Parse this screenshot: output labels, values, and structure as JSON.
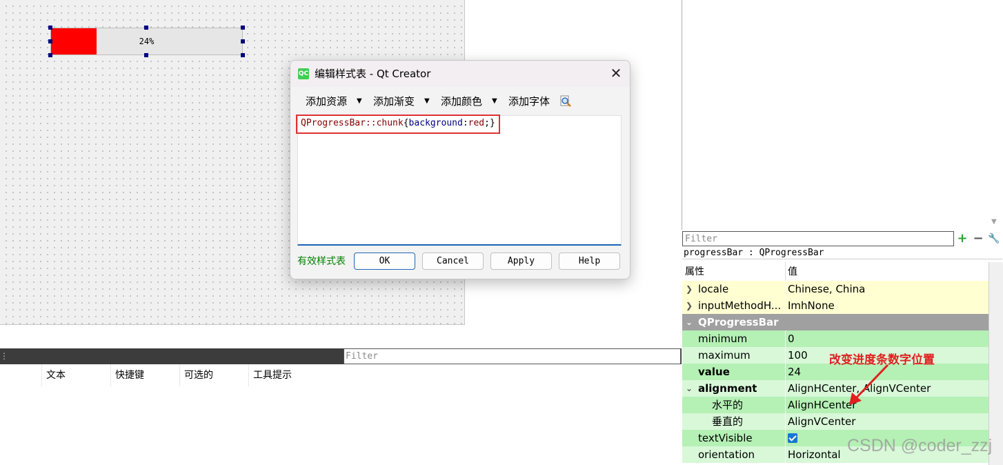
{
  "canvas": {
    "progress_bar": {
      "value": 24,
      "text": "24%",
      "chunk_color": "#ff0000"
    }
  },
  "dialog": {
    "title": "编辑样式表 - Qt Creator",
    "logo_text": "QC",
    "close_icon": "close-icon",
    "toolbar": {
      "add_resource": "添加资源",
      "add_gradient": "添加渐变",
      "add_color": "添加颜色",
      "add_font": "添加字体"
    },
    "code": {
      "selector": "QProgressBar::chunk",
      "open_brace": "{",
      "property": "background",
      "colon": ":",
      "value": "red",
      "semicolon": ";",
      "close_brace": "}"
    },
    "valid_label": "有效样式表",
    "buttons": {
      "ok": "OK",
      "cancel": "Cancel",
      "apply": "Apply",
      "help": "Help"
    }
  },
  "action_editor": {
    "filter_placeholder": "Filter",
    "columns": [
      "文本",
      "快捷键",
      "可选的",
      "工具提示"
    ]
  },
  "property_editor": {
    "filter_placeholder": "Filter",
    "object_name": "progressBar : QProgressBar",
    "header": {
      "property": "属性",
      "value": "值"
    },
    "rows": [
      {
        "name": "locale",
        "value": "Chinese, China"
      },
      {
        "name": "inputMethodH...",
        "value": "ImhNone"
      },
      {
        "name": "QProgressBar",
        "value": ""
      },
      {
        "name": "minimum",
        "value": "0"
      },
      {
        "name": "maximum",
        "value": "100"
      },
      {
        "name": "value",
        "value": "24"
      },
      {
        "name": "alignment",
        "value": "AlignHCenter, AlignVCenter"
      },
      {
        "name": "水平的",
        "value": "AlignHCenter"
      },
      {
        "name": "垂直的",
        "value": "AlignVCenter"
      },
      {
        "name": "textVisible",
        "value": ""
      },
      {
        "name": "orientation",
        "value": "Horizontal"
      }
    ],
    "text_visible_checked": true
  },
  "annotation": "改变进度条数字位置",
  "watermark": "CSDN @coder_zzj"
}
